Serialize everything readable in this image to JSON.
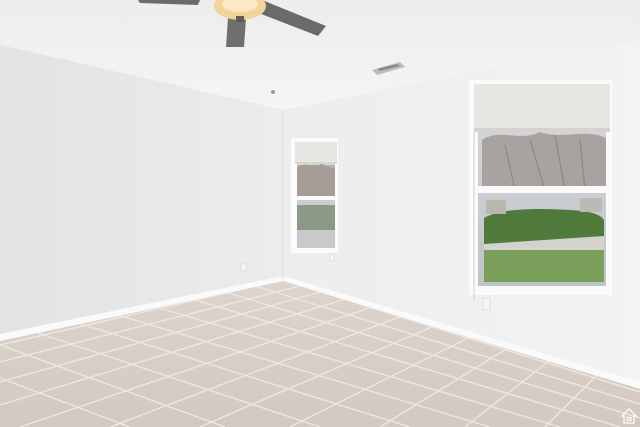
{
  "scene": {
    "description_free": true,
    "colors": {
      "ceiling": "#f2f2f2",
      "left_wall": "#e9e9e9",
      "right_wall": "#f1f1f1",
      "back_wall": "#e4e4e4",
      "floor_tile": "#d8cfc8",
      "grout": "#ece6e1",
      "baseboard": "#fafafa",
      "window_frame": "#fbfbfb",
      "blind": "#e8e6e2",
      "sky": "#c8ccd2",
      "lawn": "#7aa05c",
      "hedge": "#4f7a3c",
      "fan_blade": "#6b6b6b",
      "fan_light": "#f3d39a"
    },
    "icons": {
      "fan": "ceiling-fan-icon",
      "vent": "air-vent-icon",
      "outlet": "wall-outlet-icon",
      "logo": "equal-housing-logo-icon"
    }
  },
  "logo": {
    "text": "⌂"
  }
}
